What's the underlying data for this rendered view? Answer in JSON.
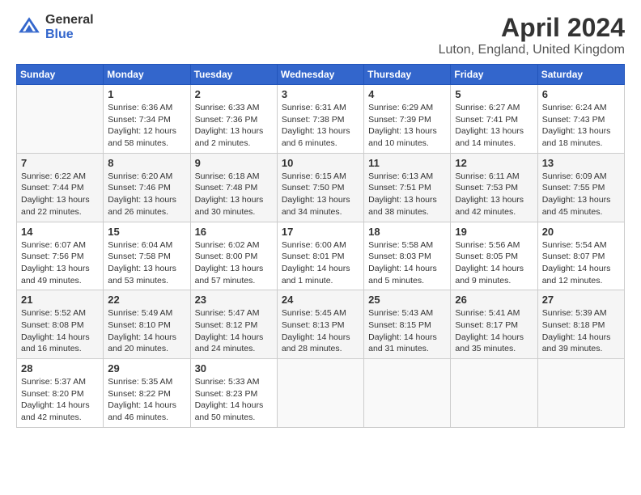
{
  "logo": {
    "general": "General",
    "blue": "Blue"
  },
  "title": "April 2024",
  "subtitle": "Luton, England, United Kingdom",
  "columns": [
    "Sunday",
    "Monday",
    "Tuesday",
    "Wednesday",
    "Thursday",
    "Friday",
    "Saturday"
  ],
  "weeks": [
    [
      {
        "day": "",
        "info": ""
      },
      {
        "day": "1",
        "info": "Sunrise: 6:36 AM\nSunset: 7:34 PM\nDaylight: 12 hours\nand 58 minutes."
      },
      {
        "day": "2",
        "info": "Sunrise: 6:33 AM\nSunset: 7:36 PM\nDaylight: 13 hours\nand 2 minutes."
      },
      {
        "day": "3",
        "info": "Sunrise: 6:31 AM\nSunset: 7:38 PM\nDaylight: 13 hours\nand 6 minutes."
      },
      {
        "day": "4",
        "info": "Sunrise: 6:29 AM\nSunset: 7:39 PM\nDaylight: 13 hours\nand 10 minutes."
      },
      {
        "day": "5",
        "info": "Sunrise: 6:27 AM\nSunset: 7:41 PM\nDaylight: 13 hours\nand 14 minutes."
      },
      {
        "day": "6",
        "info": "Sunrise: 6:24 AM\nSunset: 7:43 PM\nDaylight: 13 hours\nand 18 minutes."
      }
    ],
    [
      {
        "day": "7",
        "info": "Sunrise: 6:22 AM\nSunset: 7:44 PM\nDaylight: 13 hours\nand 22 minutes."
      },
      {
        "day": "8",
        "info": "Sunrise: 6:20 AM\nSunset: 7:46 PM\nDaylight: 13 hours\nand 26 minutes."
      },
      {
        "day": "9",
        "info": "Sunrise: 6:18 AM\nSunset: 7:48 PM\nDaylight: 13 hours\nand 30 minutes."
      },
      {
        "day": "10",
        "info": "Sunrise: 6:15 AM\nSunset: 7:50 PM\nDaylight: 13 hours\nand 34 minutes."
      },
      {
        "day": "11",
        "info": "Sunrise: 6:13 AM\nSunset: 7:51 PM\nDaylight: 13 hours\nand 38 minutes."
      },
      {
        "day": "12",
        "info": "Sunrise: 6:11 AM\nSunset: 7:53 PM\nDaylight: 13 hours\nand 42 minutes."
      },
      {
        "day": "13",
        "info": "Sunrise: 6:09 AM\nSunset: 7:55 PM\nDaylight: 13 hours\nand 45 minutes."
      }
    ],
    [
      {
        "day": "14",
        "info": "Sunrise: 6:07 AM\nSunset: 7:56 PM\nDaylight: 13 hours\nand 49 minutes."
      },
      {
        "day": "15",
        "info": "Sunrise: 6:04 AM\nSunset: 7:58 PM\nDaylight: 13 hours\nand 53 minutes."
      },
      {
        "day": "16",
        "info": "Sunrise: 6:02 AM\nSunset: 8:00 PM\nDaylight: 13 hours\nand 57 minutes."
      },
      {
        "day": "17",
        "info": "Sunrise: 6:00 AM\nSunset: 8:01 PM\nDaylight: 14 hours\nand 1 minute."
      },
      {
        "day": "18",
        "info": "Sunrise: 5:58 AM\nSunset: 8:03 PM\nDaylight: 14 hours\nand 5 minutes."
      },
      {
        "day": "19",
        "info": "Sunrise: 5:56 AM\nSunset: 8:05 PM\nDaylight: 14 hours\nand 9 minutes."
      },
      {
        "day": "20",
        "info": "Sunrise: 5:54 AM\nSunset: 8:07 PM\nDaylight: 14 hours\nand 12 minutes."
      }
    ],
    [
      {
        "day": "21",
        "info": "Sunrise: 5:52 AM\nSunset: 8:08 PM\nDaylight: 14 hours\nand 16 minutes."
      },
      {
        "day": "22",
        "info": "Sunrise: 5:49 AM\nSunset: 8:10 PM\nDaylight: 14 hours\nand 20 minutes."
      },
      {
        "day": "23",
        "info": "Sunrise: 5:47 AM\nSunset: 8:12 PM\nDaylight: 14 hours\nand 24 minutes."
      },
      {
        "day": "24",
        "info": "Sunrise: 5:45 AM\nSunset: 8:13 PM\nDaylight: 14 hours\nand 28 minutes."
      },
      {
        "day": "25",
        "info": "Sunrise: 5:43 AM\nSunset: 8:15 PM\nDaylight: 14 hours\nand 31 minutes."
      },
      {
        "day": "26",
        "info": "Sunrise: 5:41 AM\nSunset: 8:17 PM\nDaylight: 14 hours\nand 35 minutes."
      },
      {
        "day": "27",
        "info": "Sunrise: 5:39 AM\nSunset: 8:18 PM\nDaylight: 14 hours\nand 39 minutes."
      }
    ],
    [
      {
        "day": "28",
        "info": "Sunrise: 5:37 AM\nSunset: 8:20 PM\nDaylight: 14 hours\nand 42 minutes."
      },
      {
        "day": "29",
        "info": "Sunrise: 5:35 AM\nSunset: 8:22 PM\nDaylight: 14 hours\nand 46 minutes."
      },
      {
        "day": "30",
        "info": "Sunrise: 5:33 AM\nSunset: 8:23 PM\nDaylight: 14 hours\nand 50 minutes."
      },
      {
        "day": "",
        "info": ""
      },
      {
        "day": "",
        "info": ""
      },
      {
        "day": "",
        "info": ""
      },
      {
        "day": "",
        "info": ""
      }
    ]
  ]
}
